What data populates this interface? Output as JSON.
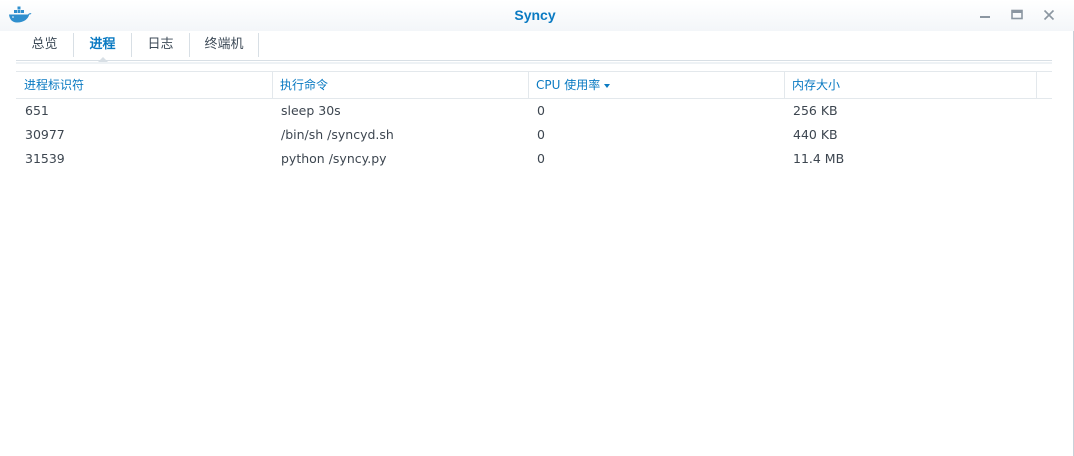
{
  "window": {
    "title": "Syncy",
    "icon": "docker-whale-icon",
    "controls": [
      "minimize-icon",
      "maximize-icon",
      "close-icon"
    ]
  },
  "tabs": [
    {
      "label": "总览",
      "active": false
    },
    {
      "label": "进程",
      "active": true
    },
    {
      "label": "日志",
      "active": false
    },
    {
      "label": "终端机",
      "active": false
    }
  ],
  "table": {
    "columns": [
      "进程标识符",
      "执行命令",
      "CPU 使用率",
      "内存大小"
    ],
    "sorted_column": "CPU 使用率",
    "rows": [
      {
        "pid": "651",
        "command": "sleep 30s",
        "cpu": "0",
        "memory": "256 KB"
      },
      {
        "pid": "30977",
        "command": "/bin/sh /syncyd.sh",
        "cpu": "0",
        "memory": "440 KB"
      },
      {
        "pid": "31539",
        "command": "python /syncy.py",
        "cpu": "0",
        "memory": "11.4 MB"
      }
    ]
  },
  "colors": {
    "accent": "#0a7ac2",
    "text": "#3d4650",
    "border": "#e3e8ec"
  }
}
